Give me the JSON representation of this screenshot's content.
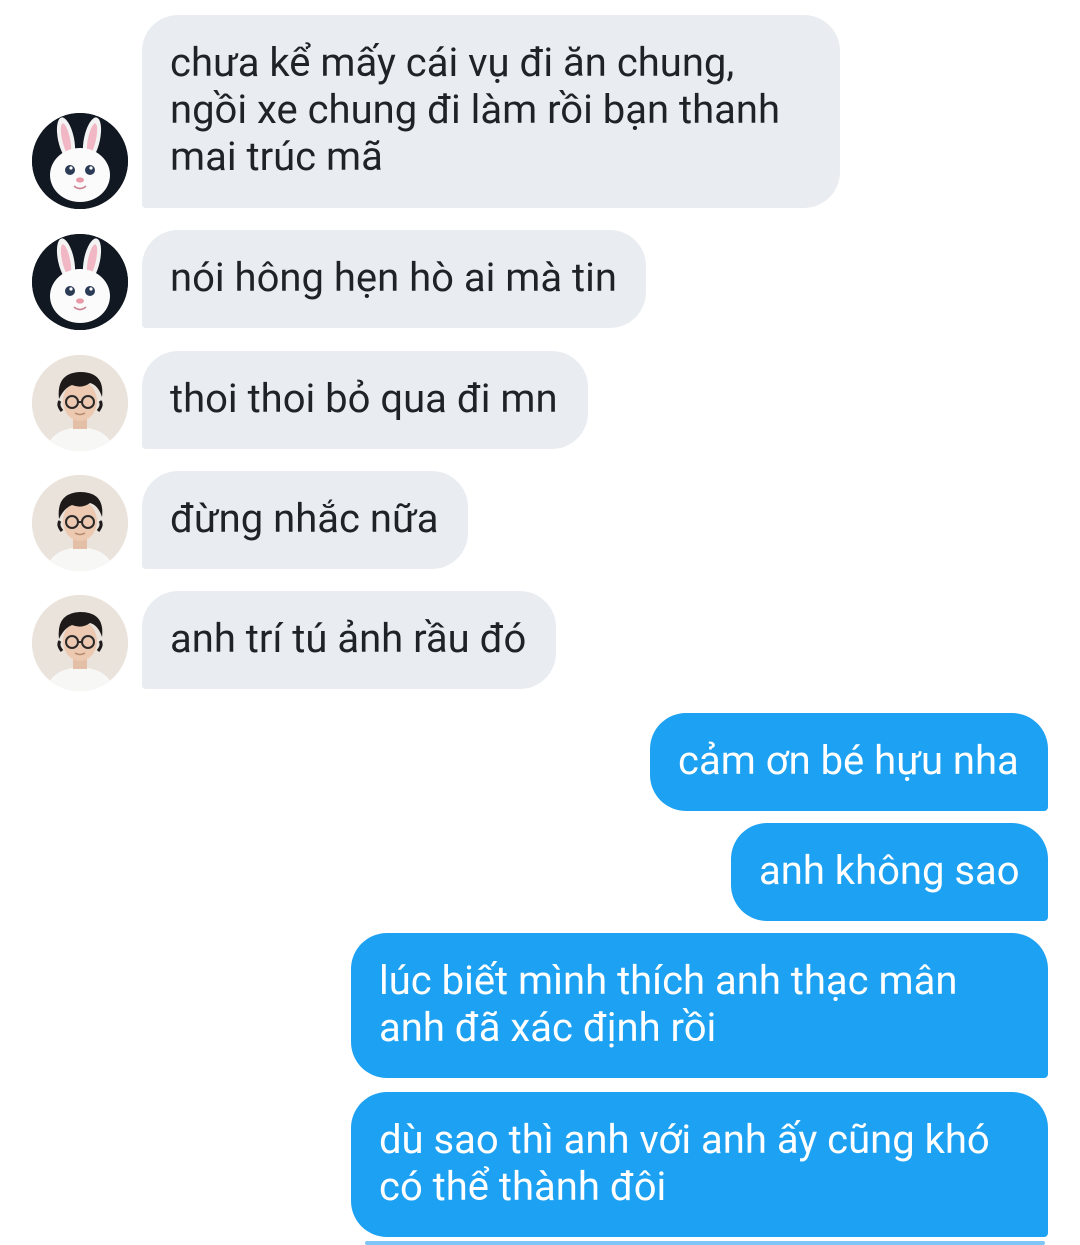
{
  "conversation": {
    "messages": [
      {
        "text": "chưa kể mấy cái vụ đi ăn chung,\nngồi xe chung đi làm rồi bạn thanh\nmai trúc mã",
        "from": "other",
        "avatar": "bunny-avatar"
      },
      {
        "text": "nói hông hẹn hò ai mà tin",
        "from": "other",
        "avatar": "bunny-avatar"
      },
      {
        "text": "thoi thoi bỏ qua đi mn",
        "from": "other",
        "avatar": "person-avatar"
      },
      {
        "text": "đừng nhắc nữa",
        "from": "other",
        "avatar": "person-avatar"
      },
      {
        "text": "anh trí tú ảnh rầu đó",
        "from": "other",
        "avatar": "person-avatar"
      },
      {
        "text": "cảm ơn bé hựu nha",
        "from": "self"
      },
      {
        "text": "anh không sao",
        "from": "self"
      },
      {
        "text": "lúc biết mình thích anh thạc mân\nanh đã xác định rồi",
        "from": "self"
      },
      {
        "text": "dù sao thì anh với anh ấy cũng khó\ncó thể thành đôi",
        "from": "self"
      }
    ]
  },
  "colors": {
    "incoming_bubble": "#e9edf1",
    "outgoing_bubble": "#1da1f2",
    "incoming_text": "#1f2328",
    "outgoing_text": "#ffffff"
  }
}
